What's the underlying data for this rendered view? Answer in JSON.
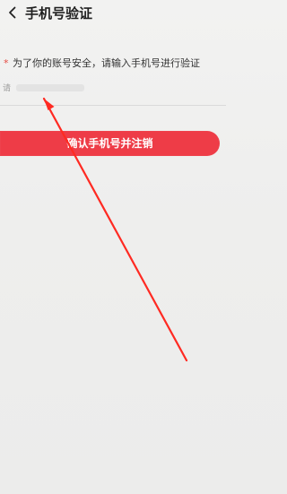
{
  "header": {
    "title": "手机号验证"
  },
  "form": {
    "required_mark": "*",
    "notice": "为了你的账号安全，请输入手机号进行验证",
    "phone_placeholder": "请",
    "phone_value": ""
  },
  "actions": {
    "confirm_label": "确认手机号并注销"
  },
  "colors": {
    "accent": "#ee3c47",
    "arrow": "#ff2a22"
  }
}
